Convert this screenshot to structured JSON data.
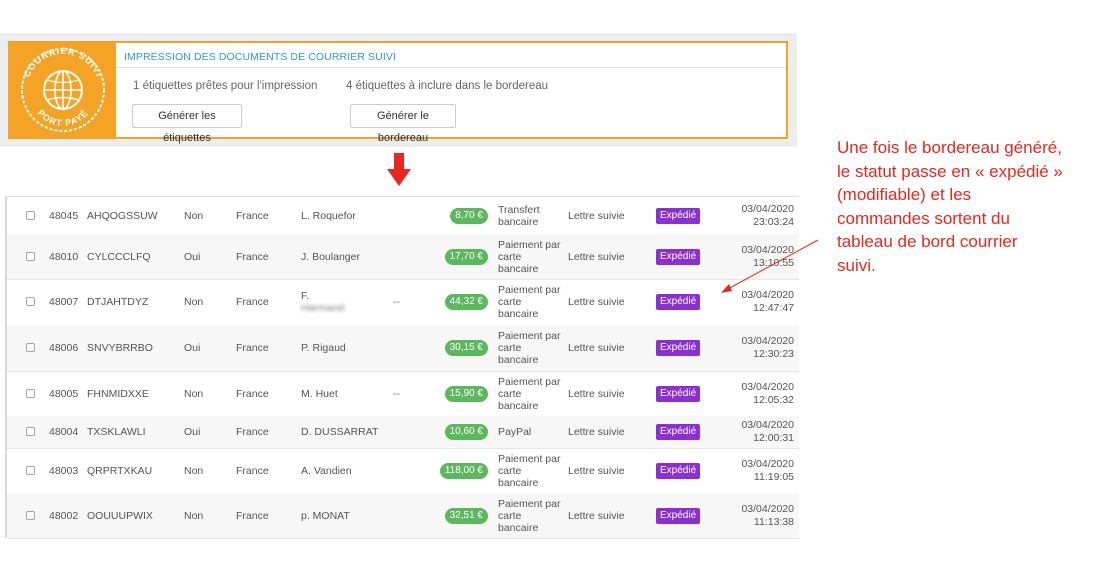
{
  "panel": {
    "title": "IMPRESSION DES DOCUMENTS DE COURRIER SUIVI",
    "ready_text": "1 étiquettes prêtes pour l'impression",
    "bordereau_text": "4 étiquettes à inclure dans le bordereau",
    "generate_labels_button": "Générer les étiquettes",
    "generate_bordereau_button": "Générer le bordereau",
    "logo_top_text": "COURRIER SUIVI",
    "logo_bottom_text": "PORT PAYÉ",
    "accent_color": "#f5a325",
    "title_color": "#2d9ad8"
  },
  "arrow": {
    "icon": "arrow-down-icon",
    "color": "#e8281e"
  },
  "orders": [
    {
      "id": "48045",
      "ref": "AHQOGSSUW",
      "new_customer": "Non",
      "country": "France",
      "name": "L. Roquefor",
      "dash": "",
      "price": "8,70 €",
      "payment": [
        "Transfert",
        "bancaire"
      ],
      "shipping": "Lettre suivie",
      "status": "Expédié",
      "date": "03/04/2020",
      "time": "23:03:24"
    },
    {
      "id": "48010",
      "ref": "CYLCCCLFQ",
      "new_customer": "Oui",
      "country": "France",
      "name": "J. Boulanger",
      "dash": "",
      "price": "17,70 €",
      "payment": [
        "Paiement par",
        "carte",
        "bancaire"
      ],
      "shipping": "Lettre suivie",
      "status": "Expédié",
      "date": "03/04/2020",
      "time": "13:10:55"
    },
    {
      "id": "48007",
      "ref": "DTJAHTDYZ",
      "new_customer": "Non",
      "country": "France",
      "name": "F.",
      "name2": "Harmand",
      "dash": "--",
      "price": "44,32 €",
      "payment": [
        "Paiement par",
        "carte",
        "bancaire"
      ],
      "shipping": "Lettre suivie",
      "status": "Expédié",
      "date": "03/04/2020",
      "time": "12:47:47"
    },
    {
      "id": "48006",
      "ref": "SNVYBRRBO",
      "new_customer": "Oui",
      "country": "France",
      "name": "P. Rigaud",
      "dash": "",
      "price": "30,15 €",
      "payment": [
        "Paiement par",
        "carte",
        "bancaire"
      ],
      "shipping": "Lettre suivie",
      "status": "Expédié",
      "date": "03/04/2020",
      "time": "12:30:23"
    },
    {
      "id": "48005",
      "ref": "FHNMIDXXE",
      "new_customer": "Non",
      "country": "France",
      "name": "M. Huet",
      "dash": "--",
      "price": "15,90 €",
      "payment": [
        "Paiement par",
        "carte",
        "bancaire"
      ],
      "shipping": "Lettre suivie",
      "status": "Expédié",
      "date": "03/04/2020",
      "time": "12:05:32"
    },
    {
      "id": "48004",
      "ref": "TXSKLAWLI",
      "new_customer": "Oui",
      "country": "France",
      "name": "D. DUSSARRAT",
      "dash": "",
      "price": "10,60 €",
      "payment": [
        "PayPal"
      ],
      "shipping": "Lettre suivie",
      "status": "Expédié",
      "date": "03/04/2020",
      "time": "12:00:31"
    },
    {
      "id": "48003",
      "ref": "QRPRTXKAU",
      "new_customer": "Non",
      "country": "France",
      "name": "A. Vandien",
      "dash": "",
      "price": "118,00 €",
      "payment": [
        "Paiement par",
        "carte",
        "bancaire"
      ],
      "shipping": "Lettre suivie",
      "status": "Expédié",
      "date": "03/04/2020",
      "time": "11:19:05"
    },
    {
      "id": "48002",
      "ref": "OOUUUPWIX",
      "new_customer": "Non",
      "country": "France",
      "name": "p. MONAT",
      "dash": "",
      "price": "32,51 €",
      "payment": [
        "Paiement par",
        "carte",
        "bancaire"
      ],
      "shipping": "Lettre suivie",
      "status": "Expédié",
      "date": "03/04/2020",
      "time": "11:13:38"
    }
  ],
  "colors": {
    "price_badge": "#5cb85c",
    "status_badge": "#8b2fd4",
    "annotation": "#e8281e"
  },
  "annotation": {
    "lines": [
      "Une fois le bordereau généré,",
      "le statut passe en « expédié »",
      "(modifiable) et les",
      "commandes sortent du",
      "tableau de bord courrier",
      "suivi."
    ]
  }
}
